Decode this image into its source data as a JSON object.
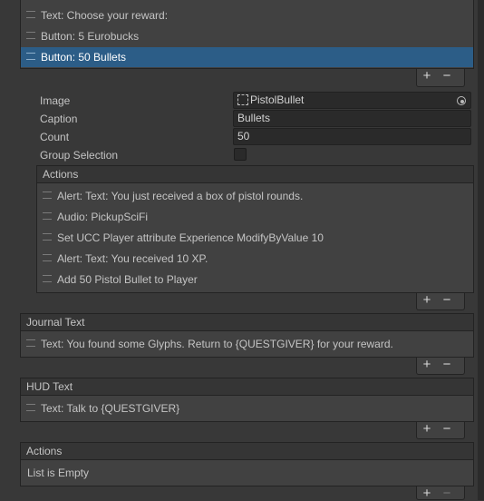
{
  "top_list": {
    "items": [
      {
        "label": "Text: Choose your reward:",
        "selected": false
      },
      {
        "label": "Button: 5 Eurobucks",
        "selected": false
      },
      {
        "label": "Button: 50 Bullets",
        "selected": true
      }
    ]
  },
  "properties": {
    "image_label": "Image",
    "image_value": "PistolBullet",
    "caption_label": "Caption",
    "caption_value": "Bullets",
    "count_label": "Count",
    "count_value": "50",
    "group_label": "Group Selection",
    "group_checked": false
  },
  "button_actions": {
    "title": "Actions",
    "items": [
      "Alert: Text: You just received a box of pistol rounds.",
      "Audio: PickupSciFi",
      "Set UCC Player attribute Experience ModifyByValue 10",
      "Alert: Text: You received 10 XP.",
      "Add 50 Pistol Bullet to Player"
    ]
  },
  "journal": {
    "title": "Journal Text",
    "items": [
      "Text: You found some Glyphs. Return to {QUESTGIVER} for your reward."
    ]
  },
  "hud": {
    "title": "HUD Text",
    "items": [
      "Text: Talk to {QUESTGIVER}"
    ]
  },
  "actions": {
    "title": "Actions",
    "empty_text": "List is Empty"
  },
  "controls": {
    "add": "+",
    "remove": "−"
  },
  "colors": {
    "selection": "#2c5d87",
    "background": "#383838",
    "panel": "#414141"
  }
}
